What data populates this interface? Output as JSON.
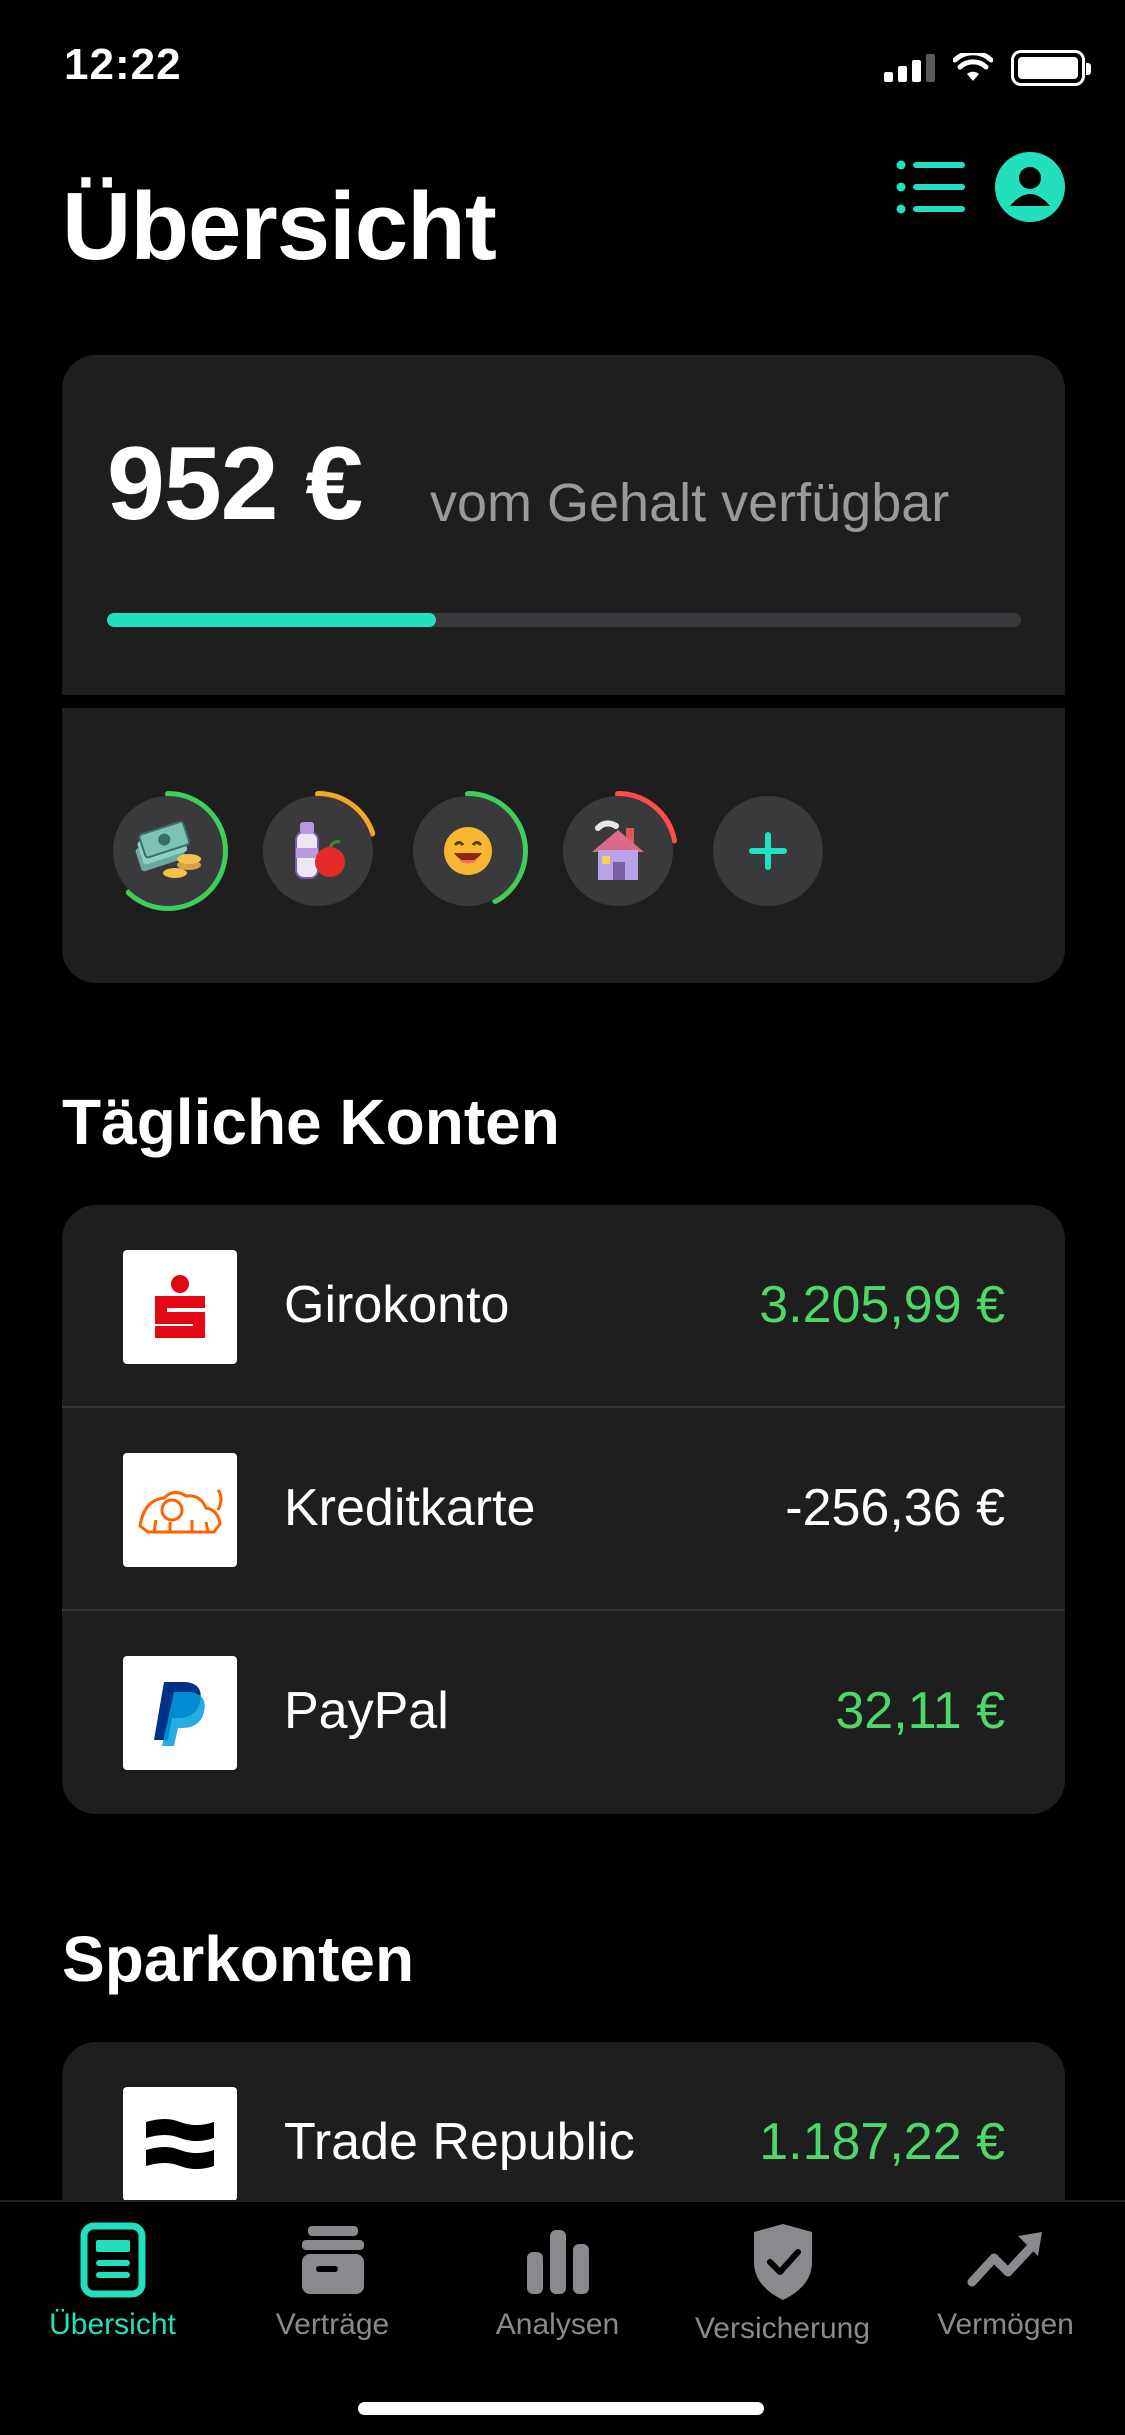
{
  "status": {
    "time": "12:22"
  },
  "header": {
    "title": "Übersicht"
  },
  "salary": {
    "amount": "952 €",
    "label": "vom Gehalt verfügbar",
    "progress": 0.36
  },
  "budgets": [
    {
      "icon": "money-stack-icon",
      "progress": 0.62,
      "color": "#3ecf5a"
    },
    {
      "icon": "groceries-icon",
      "progress": 0.2,
      "color": "#f5a623"
    },
    {
      "icon": "smiley-icon",
      "progress": 0.42,
      "color": "#3ecf5a"
    },
    {
      "icon": "house-icon",
      "progress": 0.22,
      "color": "#ff4d4d"
    }
  ],
  "daily": {
    "title": "Tägliche Konten",
    "accounts": [
      {
        "name": "Girokonto",
        "balance": "3.205,99 €",
        "logo": "sparkasse-logo-icon",
        "positive": true
      },
      {
        "name": "Kreditkarte",
        "balance": "-256,36 €",
        "logo": "ing-lion-logo-icon",
        "positive": false
      },
      {
        "name": "PayPal",
        "balance": "32,11 €",
        "logo": "paypal-logo-icon",
        "positive": true
      }
    ]
  },
  "savings": {
    "title": "Sparkonten",
    "accounts": [
      {
        "name": "Trade Republic",
        "balance": "1.187,22 €",
        "logo": "trade-republic-logo-icon",
        "positive": true
      }
    ]
  },
  "tabs": [
    {
      "label": "Übersicht",
      "icon": "overview-icon",
      "active": true
    },
    {
      "label": "Verträge",
      "icon": "contracts-icon",
      "active": false
    },
    {
      "label": "Analysen",
      "icon": "bar-chart-icon",
      "active": false
    },
    {
      "label": "Versicherung",
      "icon": "shield-check-icon",
      "active": false
    },
    {
      "label": "Vermögen",
      "icon": "trend-up-icon",
      "active": false
    }
  ],
  "colors": {
    "accent": "#22e0be",
    "positive": "#4cd96a",
    "card": "#1e1e1e"
  }
}
